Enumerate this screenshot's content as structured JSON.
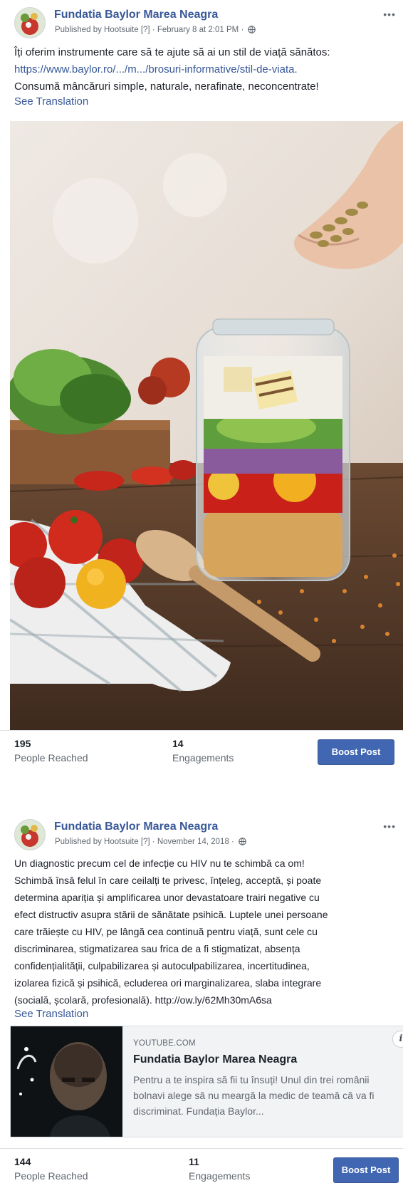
{
  "posts": [
    {
      "page_name": "Fundatia Baylor Marea Neagra",
      "meta": "Published by Hootsuite [?] · February 8 at 2:01 PM ·",
      "message_lines": [
        "Îți oferim instrumente care să te ajute să ai un stil de viață sănătos:",
        "https://www.baylor.ro/.../m.../brosuri-informative/stil-de-viata.",
        "Consumă mâncăruri simple, naturale, nerafinate, neconcentrate!"
      ],
      "see_translation": "See Translation",
      "reached_count": "195",
      "reached_label": "People Reached",
      "engagements_count": "14",
      "engagements_label": "Engagements",
      "boost_label": "Boost Post",
      "more_icon": "more-options-icon",
      "privacy_icon": "globe-icon"
    },
    {
      "page_name": "Fundatia Baylor Marea Neagra",
      "meta": "Published by Hootsuite [?] · November 14, 2018 ·",
      "message_lines": [
        "Un diagnostic precum cel de infecție cu HIV nu te schimbă ca om!",
        "Schimbă însă felul în care ceilalți te privesc, înțeleg, acceptă, și poate",
        "determina apariția și amplificarea unor devastatoare trairi negative cu",
        "efect distructiv asupra stării de sănătate psihică. Luptele unei persoane",
        "care trăiește cu HIV, pe lângă cea continuă pentru viață, sunt cele cu",
        "discriminarea, stigmatizarea sau frica de a fi stigmatizat, absența",
        "confidențialității, culpabilizarea și autoculpabilizarea, incertitudinea,",
        "izolarea fizică și psihică, ecluderea ori marginalizarea, slaba integrare",
        "(socială, școlară, profesională). http://ow.ly/62Mh30mA6sa"
      ],
      "see_translation": "See Translation",
      "link_card": {
        "domain": "YOUTUBE.COM",
        "title": "Fundatia Baylor Marea Neagra",
        "description": "Pentru a te inspira să fii tu însuți! Unul din trei românii bolnavi alege să nu meargă la medic de teamă că va fi discriminat. Fundația Baylor..."
      },
      "reached_count": "144",
      "reached_label": "People Reached",
      "engagements_count": "11",
      "engagements_label": "Engagements",
      "boost_label": "Boost Post",
      "more_icon": "more-options-icon",
      "privacy_icon": "globe-icon"
    }
  ],
  "colors": {
    "link": "#385898",
    "boost": "#4267b2",
    "text": "#1d2129",
    "secondary": "#606770"
  }
}
